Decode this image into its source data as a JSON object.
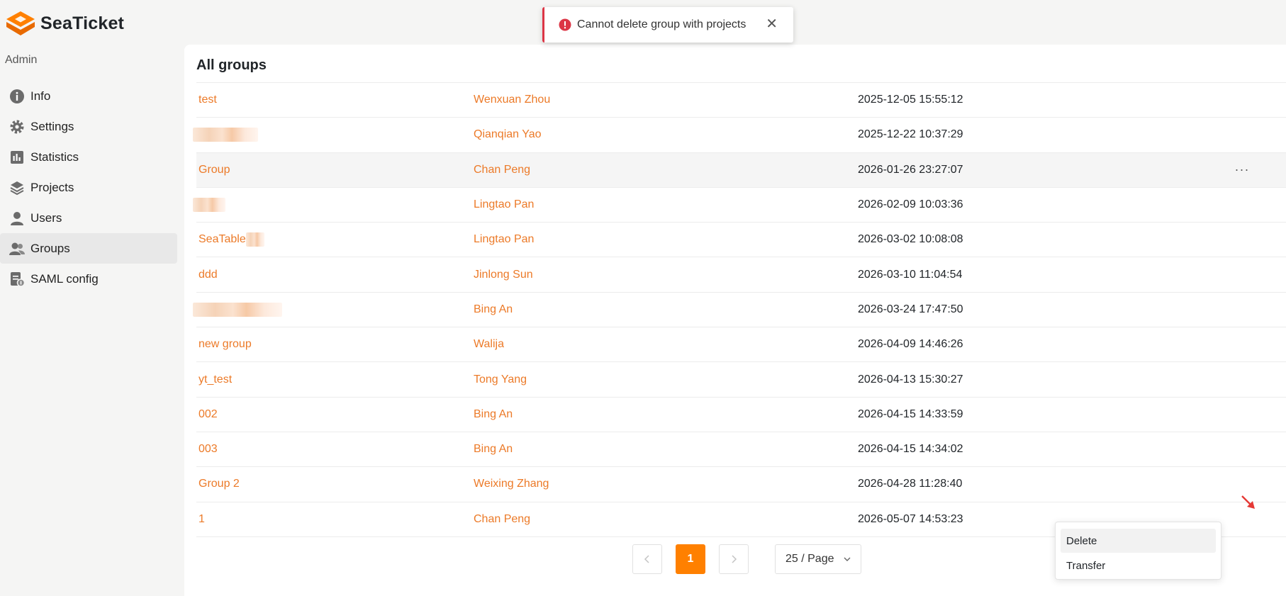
{
  "app": {
    "name": "SeaTicket",
    "brand_color": "#ff8000",
    "link_color": "#ec7a28",
    "error_color": "#dc3545"
  },
  "sidebar": {
    "section_title": "Admin",
    "items": [
      {
        "label": "Info",
        "icon": "info-icon"
      },
      {
        "label": "Settings",
        "icon": "gear-icon"
      },
      {
        "label": "Statistics",
        "icon": "statistics-icon"
      },
      {
        "label": "Projects",
        "icon": "layers-icon"
      },
      {
        "label": "Users",
        "icon": "user-icon"
      },
      {
        "label": "Groups",
        "icon": "users-icon",
        "active": true
      },
      {
        "label": "SAML config",
        "icon": "saml-icon"
      }
    ]
  },
  "main": {
    "title": "All groups",
    "rows": [
      {
        "name": "test",
        "owner": "Wenxuan Zhou",
        "created": "2025-12-05 15:55:12"
      },
      {
        "name": "",
        "owner": "Qianqian Yao",
        "created": "2025-12-22 10:37:29"
      },
      {
        "name": "Group",
        "owner": "Chan Peng",
        "created": "2026-01-26 23:27:07"
      },
      {
        "name": "",
        "owner": "Lingtao Pan",
        "created": "2026-02-09 10:03:36"
      },
      {
        "name": "SeaTable",
        "owner": "Lingtao Pan",
        "created": "2026-03-02 10:08:08"
      },
      {
        "name": "ddd",
        "owner": "Jinlong Sun",
        "created": "2026-03-10 11:04:54"
      },
      {
        "name": "",
        "owner": "Bing An",
        "created": "2026-03-24 17:47:50"
      },
      {
        "name": "new group",
        "owner": "Walija",
        "created": "2026-04-09 14:46:26"
      },
      {
        "name": "yt_test",
        "owner": "Tong Yang",
        "created": "2026-04-13 15:30:27"
      },
      {
        "name": "002",
        "owner": "Bing An",
        "created": "2026-04-15 14:33:59"
      },
      {
        "name": "003",
        "owner": "Bing An",
        "created": "2026-04-15 14:34:02"
      },
      {
        "name": "Group 2",
        "owner": "Weixing Zhang",
        "created": "2026-04-28 11:28:40"
      },
      {
        "name": "1",
        "owner": "Chan Peng",
        "created": "2026-05-07 14:53:23"
      }
    ],
    "ops_label": "···"
  },
  "pagination": {
    "current_page": "1",
    "page_size": "25 / Page",
    "prev_icon": "chevron-left-icon",
    "next_icon": "chevron-right-icon"
  },
  "toast": {
    "message": "Cannot delete group with projects",
    "close": "✕",
    "icon": "error-circle-icon"
  },
  "dropdown": {
    "items": [
      "Delete",
      "Transfer"
    ]
  }
}
